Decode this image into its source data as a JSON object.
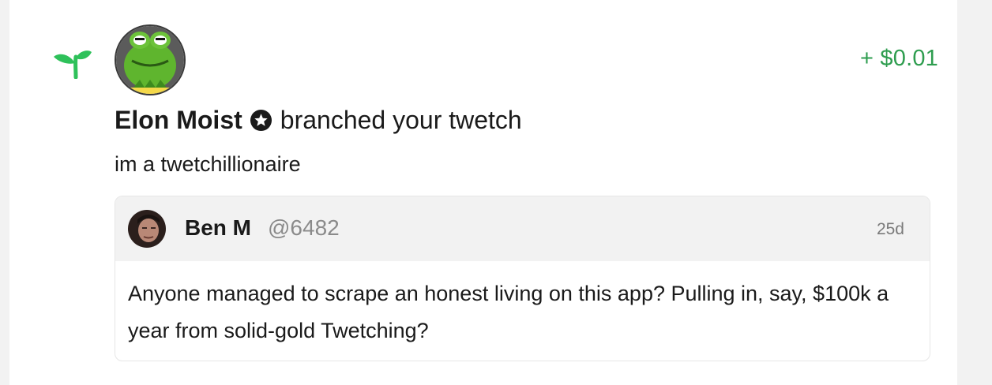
{
  "notification": {
    "icon": "sprout-icon",
    "amount": "+ $0.01",
    "actor_name": "Elon Moist",
    "action_text": "branched your twetch",
    "message": "im a twetchillionaire",
    "colors": {
      "amount": "#2e9d4f",
      "sprout": "#2ec15a"
    }
  },
  "quoted_post": {
    "author_name": "Ben M",
    "author_handle": "@6482",
    "age": "25d",
    "text": "Anyone managed to scrape an honest living on this app? Pulling in, say, $100k a year from solid-gold Twetching?"
  }
}
